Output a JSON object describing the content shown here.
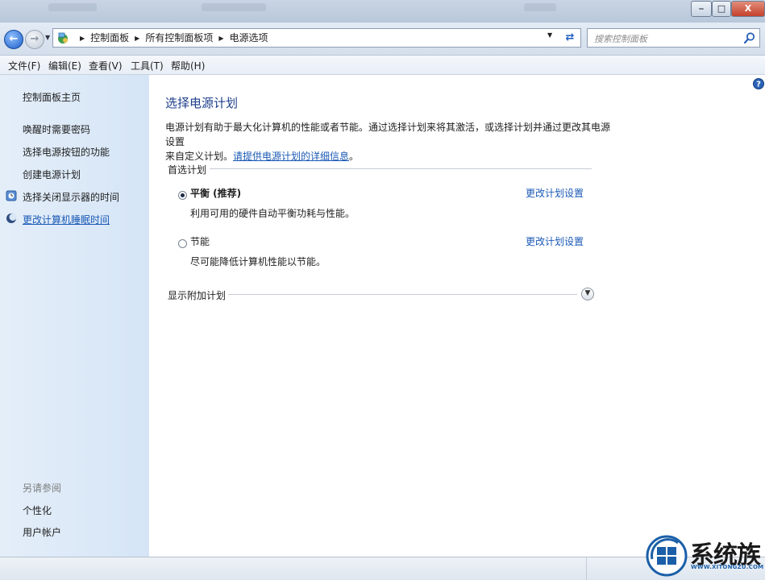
{
  "window": {
    "minimize_icon": "minimize-icon",
    "maximize_icon": "maximize-icon",
    "close_label": "X"
  },
  "address_bar": {
    "breadcrumb": [
      "控制面板",
      "所有控制面板项",
      "电源选项"
    ],
    "search_placeholder": "搜索控制面板"
  },
  "menu": [
    "文件(F)",
    "编辑(E)",
    "查看(V)",
    "工具(T)",
    "帮助(H)"
  ],
  "sidebar": {
    "home": "控制面板主页",
    "links": [
      "唤醒时需要密码",
      "选择电源按钮的功能",
      "创建电源计划",
      "选择关闭显示器的时间",
      "更改计算机睡眠时间"
    ],
    "see_also_label": "另请参阅",
    "see_also": [
      "个性化",
      "用户帐户"
    ]
  },
  "main": {
    "title": "选择电源计划",
    "desc_line1": "电源计划有助于最大化计算机的性能或者节能。通过选择计划来将其激活，或选择计划并通过更改其电源设置",
    "desc_line2_prefix": "来自定义计划。",
    "desc_link": "请提供电源计划的详细信息",
    "desc_line2_suffix": "。",
    "preferred_label": "首选计划",
    "plans": [
      {
        "name": "平衡 (推荐)",
        "description": "利用可用的硬件自动平衡功耗与性能。",
        "link": "更改计划设置",
        "selected": true
      },
      {
        "name": "节能",
        "description": "尽可能降低计算机性能以节能。",
        "link": "更改计划设置",
        "selected": false
      }
    ],
    "additional_label": "显示附加计划"
  },
  "watermark": {
    "text": "系统族",
    "url": "WWW.XITONGZU.COM"
  },
  "colors": {
    "link": "#1a59b5",
    "heading": "#1e3f8a",
    "sidebar_bg": "#dce9f7"
  }
}
